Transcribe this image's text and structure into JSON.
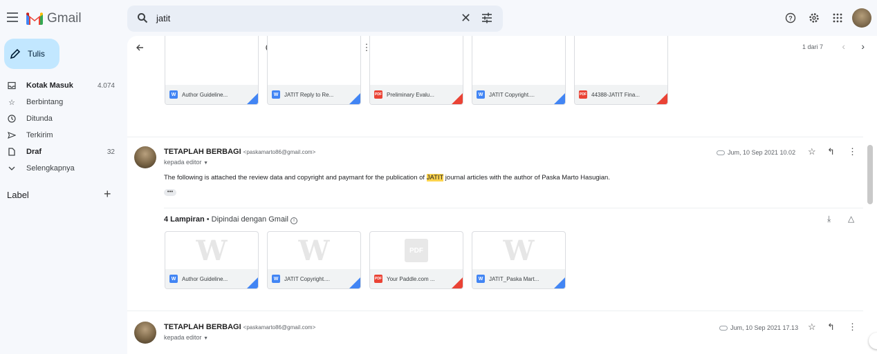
{
  "app": {
    "name": "Gmail"
  },
  "search": {
    "query": "jatit"
  },
  "sidebar": {
    "compose_label": "Tulis",
    "items": [
      {
        "label": "Kotak Masuk",
        "count": "4.074",
        "icon": "inbox-icon",
        "bold": true
      },
      {
        "label": "Berbintang",
        "count": "",
        "icon": "star-icon",
        "bold": false
      },
      {
        "label": "Ditunda",
        "count": "",
        "icon": "clock-icon",
        "bold": false
      },
      {
        "label": "Terkirim",
        "count": "",
        "icon": "send-icon",
        "bold": false
      },
      {
        "label": "Draf",
        "count": "32",
        "icon": "draft-icon",
        "bold": true
      },
      {
        "label": "Selengkapnya",
        "count": "",
        "icon": "chevron-down-icon",
        "bold": false
      }
    ],
    "labels_title": "Label"
  },
  "toolbar": {
    "pager": "1 dari 7"
  },
  "top_attachments": [
    {
      "name": "Author Guideline...",
      "type": "W",
      "color": "blue"
    },
    {
      "name": "JATIT Reply to Re...",
      "type": "W",
      "color": "blue"
    },
    {
      "name": "Preliminary Evalu...",
      "type": "PDF",
      "color": "red"
    },
    {
      "name": "JATIT Copyright....",
      "type": "W",
      "color": "blue"
    },
    {
      "name": "44388-JATIT Fina...",
      "type": "PDF",
      "color": "red"
    }
  ],
  "messages": [
    {
      "sender": "TETAPLAH BERBAGI",
      "email": "<paskamarto86@gmail.com>",
      "to": "kepada editor",
      "date": "Jum, 10 Sep 2021 10.02",
      "body_before": "The following is attached the review data and copyright and paymant for the publication of ",
      "body_highlight": "JATIT",
      "body_after": " journal articles with the author of Paska Marto Hasugian.",
      "ellipsis": "•••",
      "attachments_count": "4 Lampiran",
      "attachments_scan": "• Dipindai dengan Gmail",
      "attachments": [
        {
          "name": "Author Guideline...",
          "type": "W",
          "color": "blue",
          "thumb": "W"
        },
        {
          "name": "JATIT Copyright....",
          "type": "W",
          "color": "blue",
          "thumb": "W"
        },
        {
          "name": "Your Paddle.com ...",
          "type": "PDF",
          "color": "red",
          "thumb": "PDF"
        },
        {
          "name": "JATIT_Paska Mart...",
          "type": "W",
          "color": "blue",
          "thumb": "W"
        }
      ]
    },
    {
      "sender": "TETAPLAH BERBAGI",
      "email": "<paskamarto86@gmail.com>",
      "to": "kepada editor",
      "date": "Jum, 10 Sep 2021 17.13"
    }
  ]
}
